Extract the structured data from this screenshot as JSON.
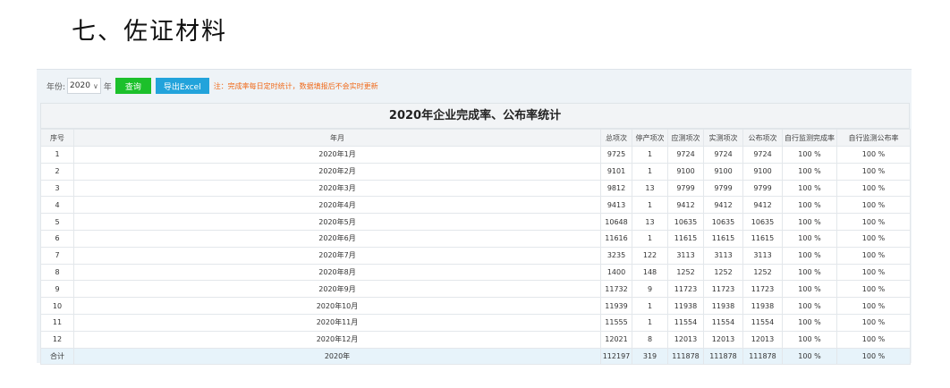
{
  "page": {
    "heading": "七、佐证材料"
  },
  "toolbar": {
    "year_label": "年份:",
    "year_value": "2020",
    "year_unit": "年",
    "query_label": "查询",
    "export_label": "导出Excel",
    "note": "注：完成率每日定时统计，数据填报后不会实时更新",
    "colors": {
      "query": "#1cc02b",
      "export": "#22a3db",
      "note": "#f06a1a"
    }
  },
  "table": {
    "title": "2020年企业完成率、公布率统计",
    "headers": [
      "序号",
      "年月",
      "总项次",
      "停产项次",
      "应测项次",
      "实测项次",
      "公布项次",
      "自行监测完成率",
      "自行监测公布率"
    ],
    "rows": [
      [
        "1",
        "2020年1月",
        "9725",
        "1",
        "9724",
        "9724",
        "9724",
        "100 %",
        "100 %"
      ],
      [
        "2",
        "2020年2月",
        "9101",
        "1",
        "9100",
        "9100",
        "9100",
        "100 %",
        "100 %"
      ],
      [
        "3",
        "2020年3月",
        "9812",
        "13",
        "9799",
        "9799",
        "9799",
        "100 %",
        "100 %"
      ],
      [
        "4",
        "2020年4月",
        "9413",
        "1",
        "9412",
        "9412",
        "9412",
        "100 %",
        "100 %"
      ],
      [
        "5",
        "2020年5月",
        "10648",
        "13",
        "10635",
        "10635",
        "10635",
        "100 %",
        "100 %"
      ],
      [
        "6",
        "2020年6月",
        "11616",
        "1",
        "11615",
        "11615",
        "11615",
        "100 %",
        "100 %"
      ],
      [
        "7",
        "2020年7月",
        "3235",
        "122",
        "3113",
        "3113",
        "3113",
        "100 %",
        "100 %"
      ],
      [
        "8",
        "2020年8月",
        "1400",
        "148",
        "1252",
        "1252",
        "1252",
        "100 %",
        "100 %"
      ],
      [
        "9",
        "2020年9月",
        "11732",
        "9",
        "11723",
        "11723",
        "11723",
        "100 %",
        "100 %"
      ],
      [
        "10",
        "2020年10月",
        "11939",
        "1",
        "11938",
        "11938",
        "11938",
        "100 %",
        "100 %"
      ],
      [
        "11",
        "2020年11月",
        "11555",
        "1",
        "11554",
        "11554",
        "11554",
        "100 %",
        "100 %"
      ],
      [
        "12",
        "2020年12月",
        "12021",
        "8",
        "12013",
        "12013",
        "12013",
        "100 %",
        "100 %"
      ]
    ],
    "total": [
      "合计",
      "2020年",
      "112197",
      "319",
      "111878",
      "111878",
      "111878",
      "100 %",
      "100 %"
    ]
  }
}
